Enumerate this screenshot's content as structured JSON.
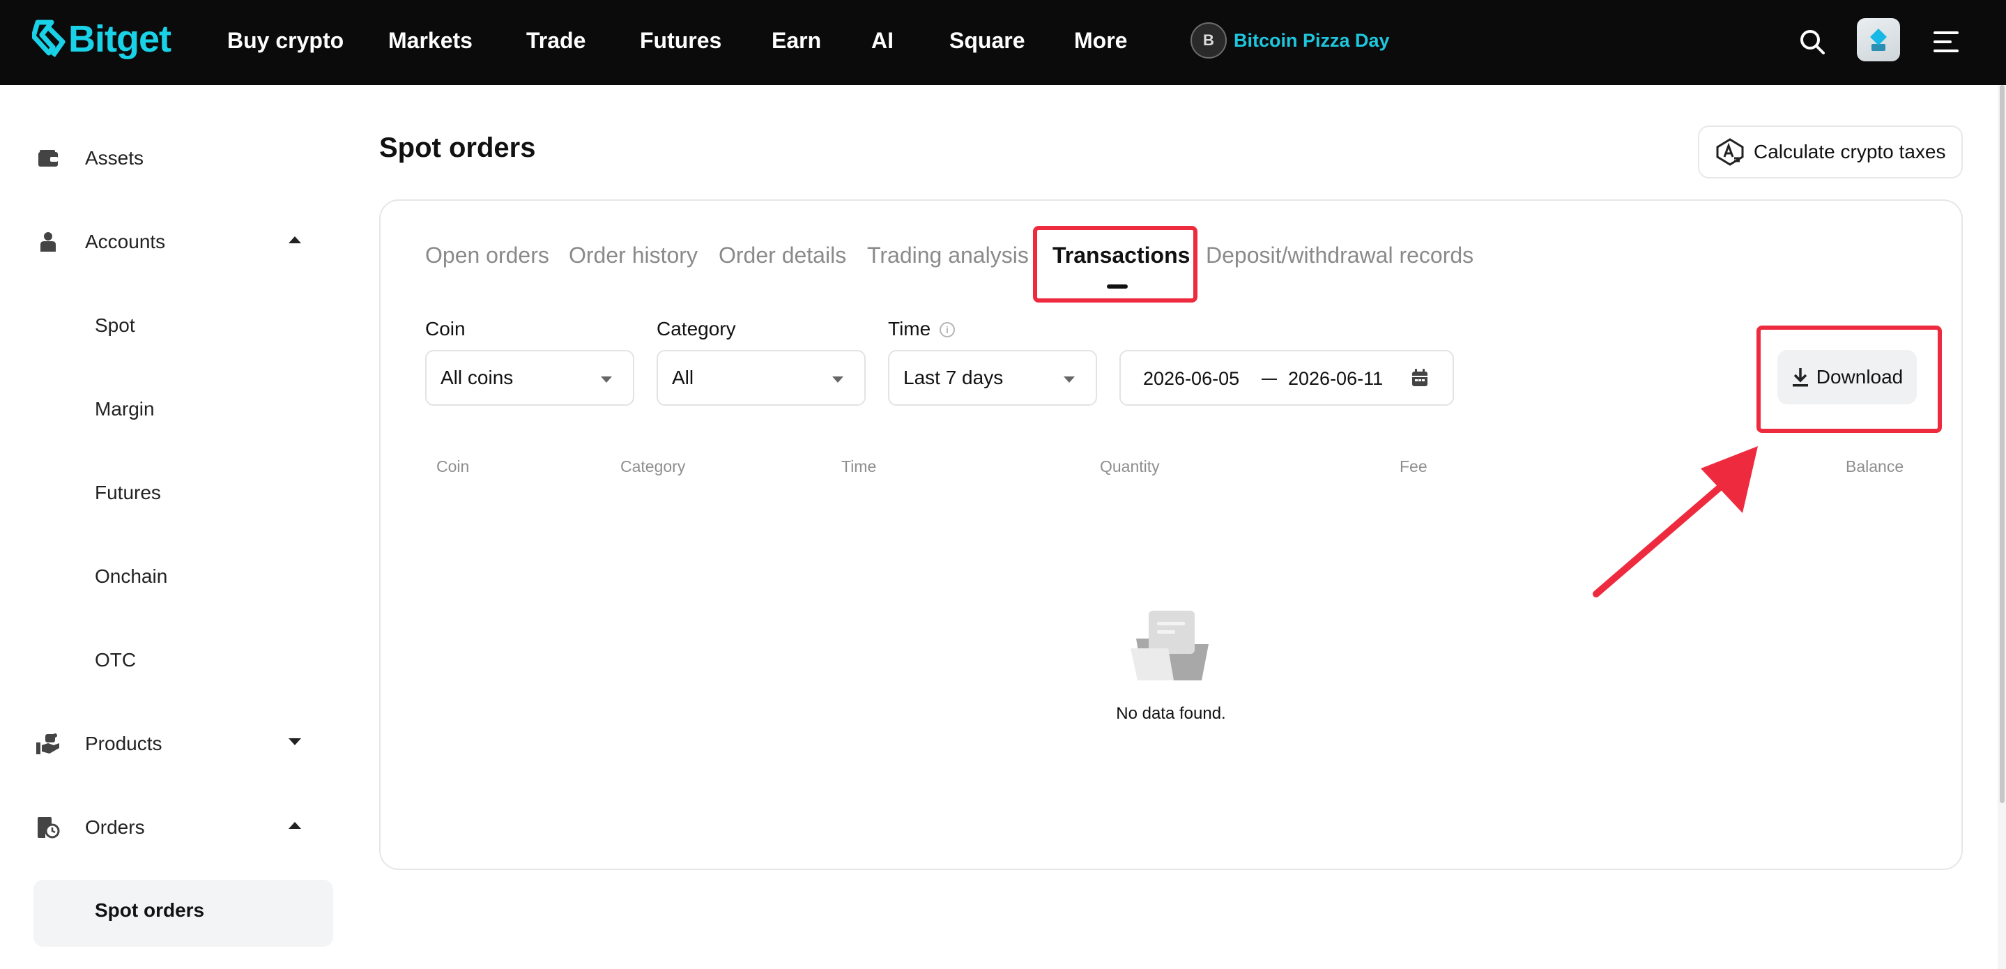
{
  "brand": {
    "name": "Bitget",
    "accent": "#1ad2e8"
  },
  "nav": {
    "items": [
      "Buy crypto",
      "Markets",
      "Trade",
      "Futures",
      "Earn",
      "AI",
      "Square",
      "More"
    ],
    "promo": {
      "badge": "B",
      "label": "Bitcoin Pizza Day"
    },
    "icons": [
      "search-icon",
      "avatar",
      "menu-icon"
    ]
  },
  "sidebar": {
    "assets": "Assets",
    "accounts": "Accounts",
    "accounts_sub": [
      "Spot",
      "Margin",
      "Futures",
      "Onchain",
      "OTC"
    ],
    "products": "Products",
    "orders": "Orders",
    "orders_active": "Spot orders"
  },
  "main": {
    "title": "Spot orders",
    "tax_button": "Calculate crypto taxes",
    "tabs": [
      {
        "label": "Open orders",
        "active": false
      },
      {
        "label": "Order history",
        "active": false
      },
      {
        "label": "Order details",
        "active": false
      },
      {
        "label": "Trading analysis",
        "active": false
      },
      {
        "label": "Transactions",
        "active": true
      },
      {
        "label": "Deposit/withdrawal records",
        "active": false
      }
    ],
    "filters": {
      "coin": {
        "label": "Coin",
        "value": "All coins"
      },
      "category": {
        "label": "Category",
        "value": "All"
      },
      "time": {
        "label": "Time",
        "value": "Last 7 days"
      },
      "date_from": "2026-06-05",
      "date_to": "2026-06-11"
    },
    "download": "Download",
    "columns": [
      "Coin",
      "Category",
      "Time",
      "Quantity",
      "Fee",
      "Balance"
    ],
    "empty_text": "No data found."
  },
  "annotation": {
    "color": "#ee2b3e"
  }
}
